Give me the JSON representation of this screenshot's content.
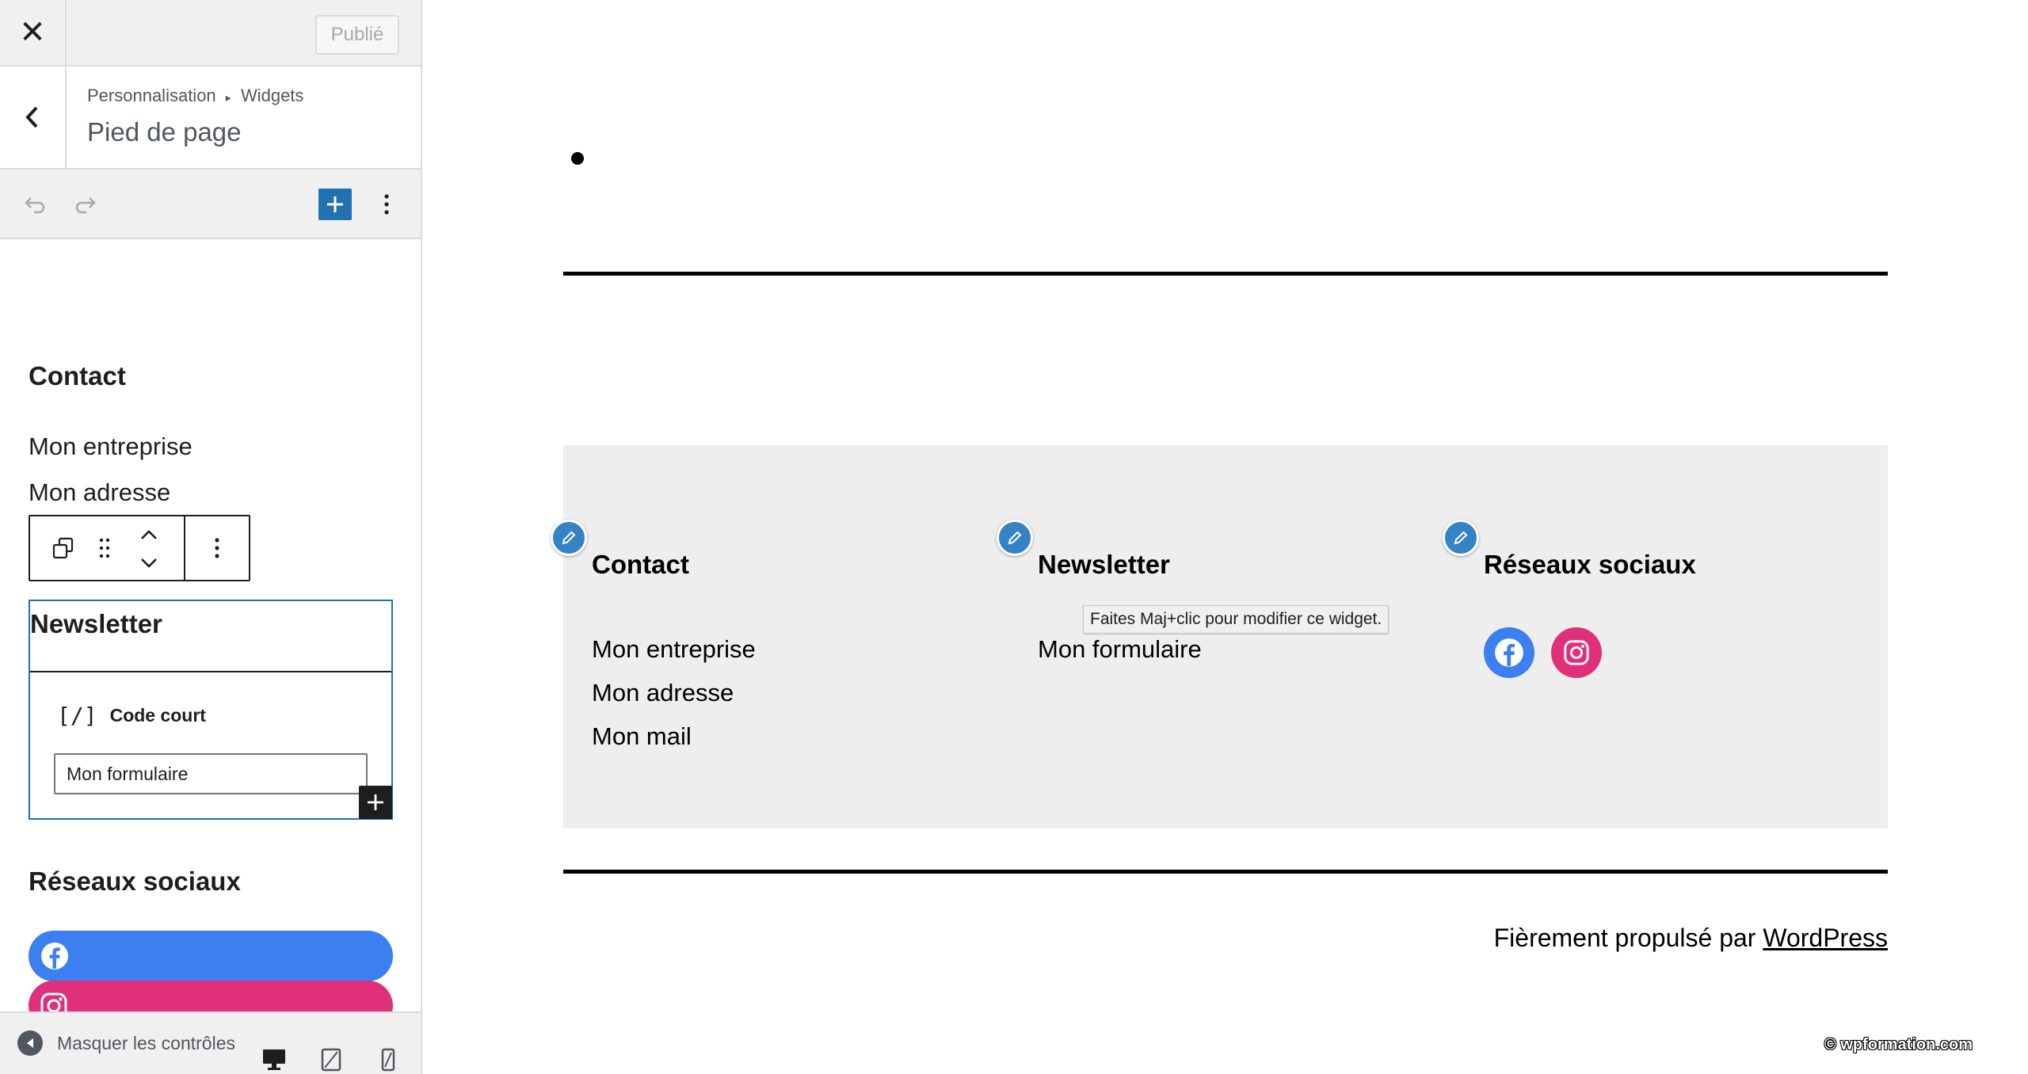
{
  "sidebar": {
    "publish_label": "Publié",
    "breadcrumb_parent": "Personnalisation",
    "breadcrumb_child": "Widgets",
    "section_title": "Pied de page",
    "contact": {
      "title": "Contact",
      "lines": [
        "Mon entreprise",
        "Mon adresse"
      ]
    },
    "newsletter": {
      "title": "Newsletter",
      "block_label": "Code court",
      "shortcode_value": "Mon formulaire"
    },
    "social": {
      "title": "Réseaux sociaux"
    },
    "footer": {
      "hide_controls_label": "Masquer les contrôles"
    }
  },
  "preview": {
    "columns": [
      {
        "title": "Contact",
        "lines": [
          "Mon entreprise",
          "Mon adresse",
          "Mon mail"
        ]
      },
      {
        "title": "Newsletter",
        "lines": [
          "Mon formulaire"
        ]
      },
      {
        "title": "Réseaux sociaux"
      }
    ],
    "tooltip": "Faites Maj+clic pour modifier ce widget.",
    "powered_prefix": "Fièrement propulsé par",
    "powered_link": "WordPress",
    "watermark": "© wpformation.com"
  },
  "colors": {
    "accent": "#2271b1",
    "facebook": "#3b7ff0",
    "instagram": "#e0307a",
    "footer_bg": "#eeeeee"
  },
  "icons": [
    "close-icon",
    "chevron-left-icon",
    "undo-icon",
    "redo-icon",
    "plus-icon",
    "more-vertical-icon",
    "duplicate-icon",
    "drag-handle-icon",
    "move-up-icon",
    "move-down-icon",
    "shortcode-icon",
    "facebook-icon",
    "instagram-icon",
    "pencil-icon",
    "desktop-icon",
    "tablet-icon",
    "mobile-icon"
  ]
}
